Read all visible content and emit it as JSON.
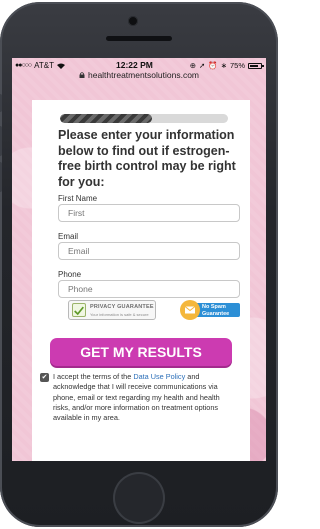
{
  "status_bar": {
    "carrier": "AT&T",
    "time": "12:22 PM",
    "battery": "75%"
  },
  "browser": {
    "url": "healthtreatmentsolutions.com"
  },
  "form": {
    "progress": 0.55,
    "headline": "Please enter your information below to find out if estrogen-free birth control may be right for you:",
    "first_name": {
      "label": "First Name",
      "placeholder": "First"
    },
    "email": {
      "label": "Email",
      "placeholder": "Email"
    },
    "phone": {
      "label": "Phone",
      "placeholder": "Phone"
    },
    "badges": {
      "privacy_title": "PRIVACY GUARANTEE",
      "privacy_sub": "Your information is safe & secure",
      "spam_line1": "No Spam",
      "spam_line2": "Guarantee"
    },
    "cta_label": "GET MY RESULTS",
    "consent": {
      "checked": true,
      "before_link": "I accept the terms of the ",
      "link_text": "Data Use Policy",
      "after_link": " and acknowledge that I will receive communications via phone, email or text regarding my health and health risks, and/or more information on treatment options available in my area."
    }
  },
  "colors": {
    "accent": "#cc3bb1",
    "link": "#2b6fb8",
    "background": "#f1c6d6"
  }
}
